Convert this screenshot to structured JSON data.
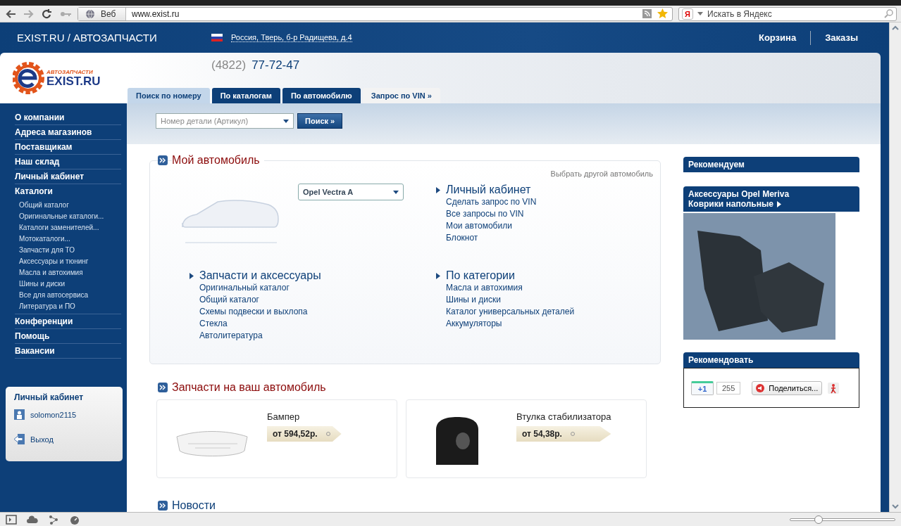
{
  "browser": {
    "address_label": "Веб",
    "url": "www.exist.ru",
    "search_badge": "Я",
    "search_placeholder": "Искать в Яндекс"
  },
  "header": {
    "title": "EXIST.RU / АВТОЗАПЧАСТИ",
    "location": "Россия, Тверь, б-р Радищева, д.4",
    "links": [
      "Корзина",
      "Заказы"
    ]
  },
  "logo": {
    "tagline": "АВТОЗАПЧАСТИ",
    "name": "EXIST.RU"
  },
  "phone": {
    "code": "(4822)",
    "number": "77-72-47"
  },
  "tabs": [
    {
      "label": "Поиск по номеру",
      "selected": true,
      "kind": "tab"
    },
    {
      "label": "По каталогам",
      "selected": false,
      "kind": "tab"
    },
    {
      "label": "По автомобилю",
      "selected": false,
      "kind": "tab"
    },
    {
      "label": "Запрос по VIN »",
      "selected": false,
      "kind": "link"
    }
  ],
  "sidebar": {
    "items": [
      {
        "label": "О компании"
      },
      {
        "label": "Адреса магазинов"
      },
      {
        "label": "Поставщикам"
      },
      {
        "label": "Наш склад"
      },
      {
        "label": "Личный кабинет"
      },
      {
        "label": "Каталоги",
        "children": [
          {
            "label": "Общий каталог"
          },
          {
            "label": "Оригинальные каталоги..."
          },
          {
            "label": "Каталоги заменителей..."
          },
          {
            "label": "Мотокаталоги..."
          },
          {
            "label": "Запчасти для ТО"
          },
          {
            "label": "Аксессуары и тюнинг"
          },
          {
            "label": "Масла и автохимия"
          },
          {
            "label": "Шины и диски"
          },
          {
            "label": "Все для автосервиса"
          },
          {
            "label": "Литература и ПО"
          }
        ]
      },
      {
        "label": "Конференции"
      },
      {
        "label": "Помощь"
      },
      {
        "label": "Вакансии"
      }
    ]
  },
  "login_box": {
    "title": "Личный кабинет",
    "user": "solomon2115",
    "logout": "Выход"
  },
  "search": {
    "placeholder": "Номер детали (Артикул)",
    "button": "Поиск »"
  },
  "my_car": {
    "title": "Мой автомобиль",
    "change_link": "Выбрать другой автомобиль",
    "model": "Opel Vectra A",
    "sections": [
      {
        "title": "Личный кабинет",
        "links": [
          "Сделать запрос по VIN",
          "Все запросы по VIN",
          "Мои автомобили",
          "Блокнот"
        ]
      },
      {
        "title": "Запчасти и аксессуары",
        "links": [
          "Оригинальный каталог",
          "Общий каталог",
          "Схемы подвески и выхлопа",
          "Стекла",
          "Автолитература"
        ]
      },
      {
        "title": "По категории",
        "links": [
          "Масла и автохимия",
          "Шины и диски",
          "Каталог универсальных деталей",
          "Аккумуляторы"
        ]
      }
    ]
  },
  "parts": {
    "title": "Запчасти на ваш автомобиль",
    "items": [
      {
        "kind": "bumper",
        "name": "Бампер",
        "price": "от 594,52р."
      },
      {
        "kind": "bushing",
        "name": "Втулка стабилизатора",
        "price": "от 54,38р."
      }
    ]
  },
  "news": {
    "title": "Новости"
  },
  "right": {
    "recommend_title": "Рекомендуем",
    "promo": {
      "title": "Аксессуары Opel Meriva",
      "link": "Коврики напольные"
    },
    "share": {
      "title": "Рекомендовать",
      "plus_label": "+1",
      "count": "255",
      "share_button": "Поделиться..."
    }
  },
  "status_bar": {
    "zoom": {
      "level": 0.27
    }
  }
}
